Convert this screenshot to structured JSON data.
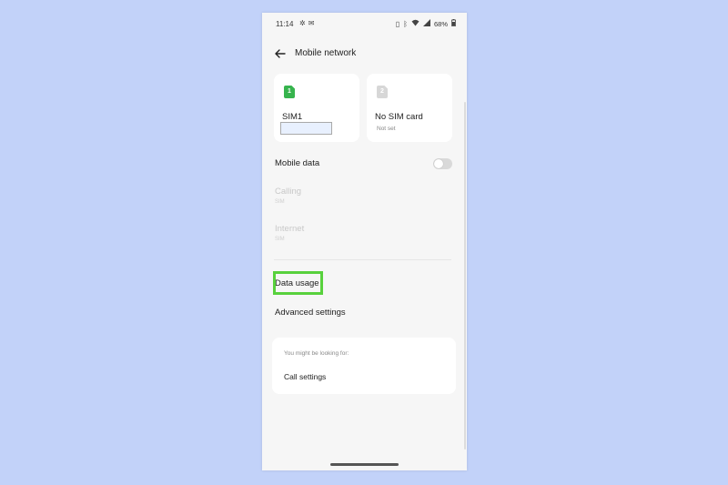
{
  "status_bar": {
    "time": "11:14",
    "left_icons": [
      "settings-fan-icon",
      "mail-icon"
    ],
    "right_icons": [
      "vibrate-icon",
      "bluetooth-icon",
      "wifi-icon",
      "signal-icon",
      "battery-icon"
    ],
    "battery": "68%"
  },
  "header": {
    "title": "Mobile network"
  },
  "sims": [
    {
      "number": "1",
      "name": "SIM1",
      "sub": ""
    },
    {
      "number": "2",
      "name": "No SIM card",
      "sub": "Not set"
    }
  ],
  "settings": {
    "mobile_data": "Mobile data",
    "mobile_data_enabled": false,
    "calling": {
      "label": "Calling",
      "sub": "SIM"
    },
    "internet": {
      "label": "Internet",
      "sub": "SIM"
    },
    "data_usage": "Data usage",
    "advanced": "Advanced settings"
  },
  "suggestions": {
    "heading": "You might be looking for:",
    "items": [
      "Call settings"
    ]
  },
  "colors": {
    "highlight": "#58d13d",
    "sim1_badge": "#37b44e",
    "background": "#c2d2f9"
  }
}
